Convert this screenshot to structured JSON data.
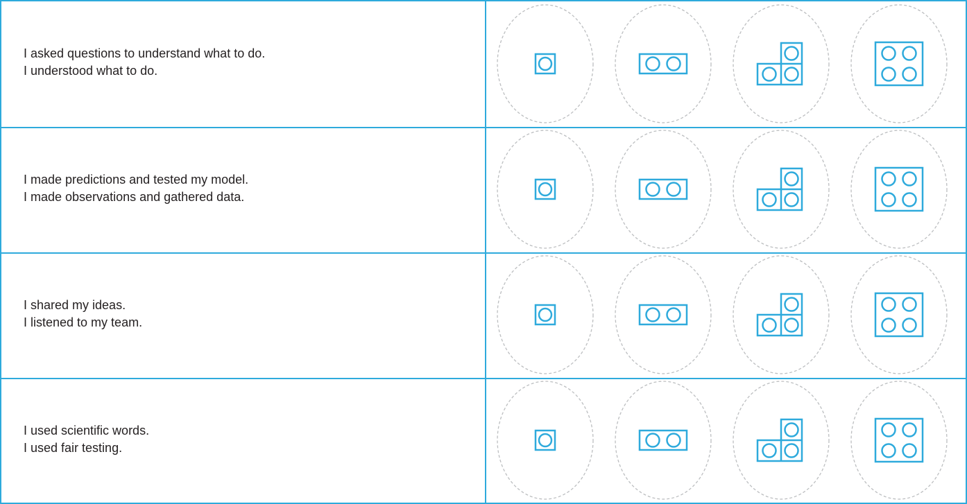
{
  "colors": {
    "accent": "#2eaadc",
    "dashed": "#bcbec0",
    "text": "#231f20"
  },
  "rows": [
    {
      "lines": [
        "I asked questions to understand what to do.",
        "I understood what to do."
      ]
    },
    {
      "lines": [
        "I made predictions and tested my model.",
        "I made observations and gathered data."
      ]
    },
    {
      "lines": [
        "I shared my ideas.",
        "I listened to my team."
      ]
    },
    {
      "lines": [
        "I used scientific words.",
        "I used fair testing."
      ]
    }
  ],
  "rating_options": [
    {
      "icon": "brick-1x1-icon",
      "studs": 1
    },
    {
      "icon": "brick-1x2-icon",
      "studs": 2
    },
    {
      "icon": "brick-corner-icon",
      "studs": 3
    },
    {
      "icon": "brick-2x2-icon",
      "studs": 4
    }
  ]
}
